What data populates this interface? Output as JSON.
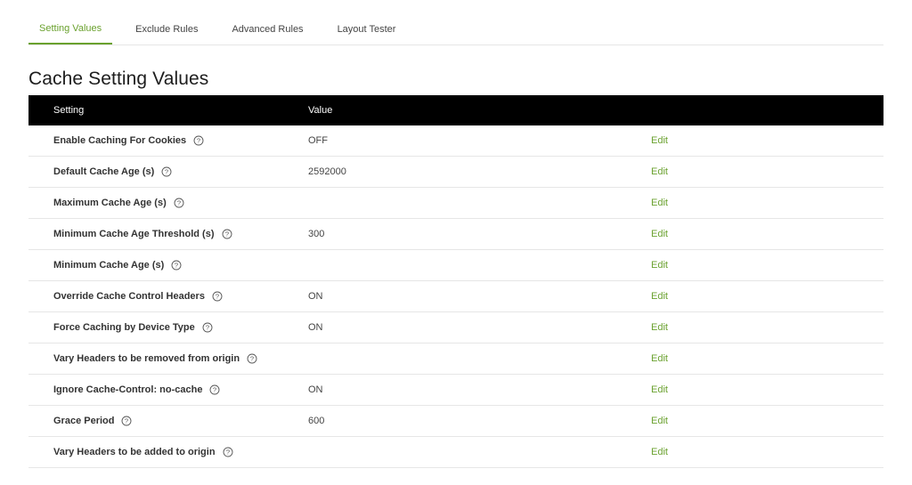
{
  "tabs": [
    {
      "label": "Setting Values",
      "active": true
    },
    {
      "label": "Exclude Rules",
      "active": false
    },
    {
      "label": "Advanced Rules",
      "active": false
    },
    {
      "label": "Layout Tester",
      "active": false
    }
  ],
  "title": "Cache Setting Values",
  "table": {
    "headers": {
      "setting": "Setting",
      "value": "Value"
    },
    "rows": [
      {
        "setting": "Enable Caching For Cookies",
        "value": "OFF",
        "action": "Edit"
      },
      {
        "setting": "Default Cache Age (s)",
        "value": "2592000",
        "action": "Edit"
      },
      {
        "setting": "Maximum Cache Age (s)",
        "value": "",
        "action": "Edit"
      },
      {
        "setting": "Minimum Cache Age Threshold (s)",
        "value": "300",
        "action": "Edit"
      },
      {
        "setting": "Minimum Cache Age (s)",
        "value": "",
        "action": "Edit"
      },
      {
        "setting": "Override Cache Control Headers",
        "value": "ON",
        "action": "Edit"
      },
      {
        "setting": "Force Caching by Device Type",
        "value": "ON",
        "action": "Edit"
      },
      {
        "setting": "Vary Headers to be removed from origin",
        "value": "",
        "action": "Edit"
      },
      {
        "setting": "Ignore Cache-Control: no-cache",
        "value": "ON",
        "action": "Edit"
      },
      {
        "setting": "Grace Period",
        "value": "600",
        "action": "Edit"
      },
      {
        "setting": "Vary Headers to be added to origin",
        "value": "",
        "action": "Edit"
      }
    ]
  },
  "icons": {
    "help": "question-circle-icon"
  },
  "colors": {
    "accent": "#6aa12e",
    "header_bg": "#000000",
    "divider": "#e6e6e6"
  }
}
